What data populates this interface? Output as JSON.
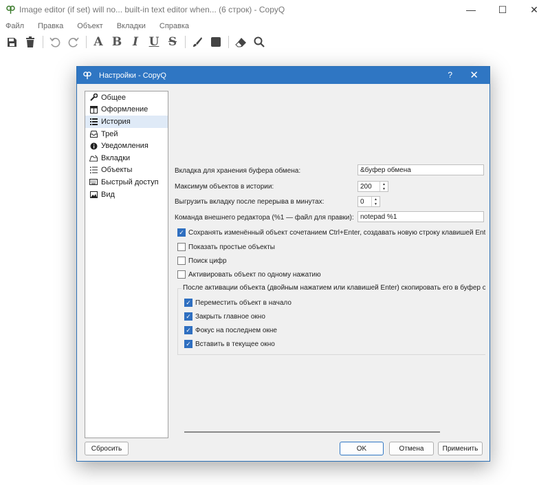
{
  "window": {
    "title": "Image editor (if set) will no... built-in text editor when... (6 строк) - CopyQ",
    "controls": {
      "minimize": "—",
      "maximize": "☐",
      "close": "✕"
    }
  },
  "menu": [
    "Файл",
    "Правка",
    "Объект",
    "Вкладки",
    "Справка"
  ],
  "toolbar": {
    "icons": [
      "save-icon",
      "trash-icon",
      "undo-icon",
      "redo-icon",
      "bold-icon",
      "italic-icon",
      "underline-icon",
      "strikethrough-icon",
      "brush-icon",
      "square-icon",
      "eraser-icon",
      "search-icon"
    ],
    "glyphs": {
      "bold": "A",
      "italic": "B",
      "underline": "I",
      "strike": "U",
      "strike2": "S"
    }
  },
  "dialog": {
    "title": "Настройки - CopyQ",
    "help": "?",
    "close": "✕",
    "nav": [
      {
        "label": "Общее",
        "icon": "wrench-icon"
      },
      {
        "label": "Оформление",
        "icon": "layout-icon"
      },
      {
        "label": "История",
        "icon": "list-icon",
        "selected": true
      },
      {
        "label": "Трей",
        "icon": "tray-icon"
      },
      {
        "label": "Уведомления",
        "icon": "info-icon"
      },
      {
        "label": "Вкладки",
        "icon": "tabs-icon"
      },
      {
        "label": "Объекты",
        "icon": "items-icon"
      },
      {
        "label": "Быстрый доступ",
        "icon": "keyboard-icon"
      },
      {
        "label": "Вид",
        "icon": "image-icon"
      }
    ],
    "history": {
      "clipboard_tab_label": "Вкладка для хранения буфера обмена:",
      "clipboard_tab_value": "&буфер обмена",
      "max_items_label": "Максимум объектов в истории:",
      "max_items_value": "200",
      "unload_label": "Выгрузить вкладку после перерыва в минутах:",
      "unload_value": "0",
      "editor_label": "Команда внешнего редактора (%1 — файл для правки):",
      "editor_value": "notepad %1",
      "save_edited_label": "Сохранять изменённый объект сочетанием Ctrl+Enter, создавать новую строку клавишей Enter",
      "show_simple_label": "Показать простые объекты",
      "number_search_label": "Поиск цифр",
      "single_click_label": "Активировать объект по одному нажатию",
      "after_activation_title": "После активации объекта (двойным нажатием или клавишей Enter) скопировать его в буфер обмена и ...",
      "move_to_top_label": "Переместить объект в начало",
      "close_main_label": "Закрыть главное окно",
      "focus_last_label": "Фокус на последнем окне",
      "paste_label": "Вставить в текущее окно"
    },
    "buttons": {
      "reset": "Сбросить",
      "ok": "OK",
      "cancel": "Отмена",
      "apply": "Применить"
    }
  }
}
